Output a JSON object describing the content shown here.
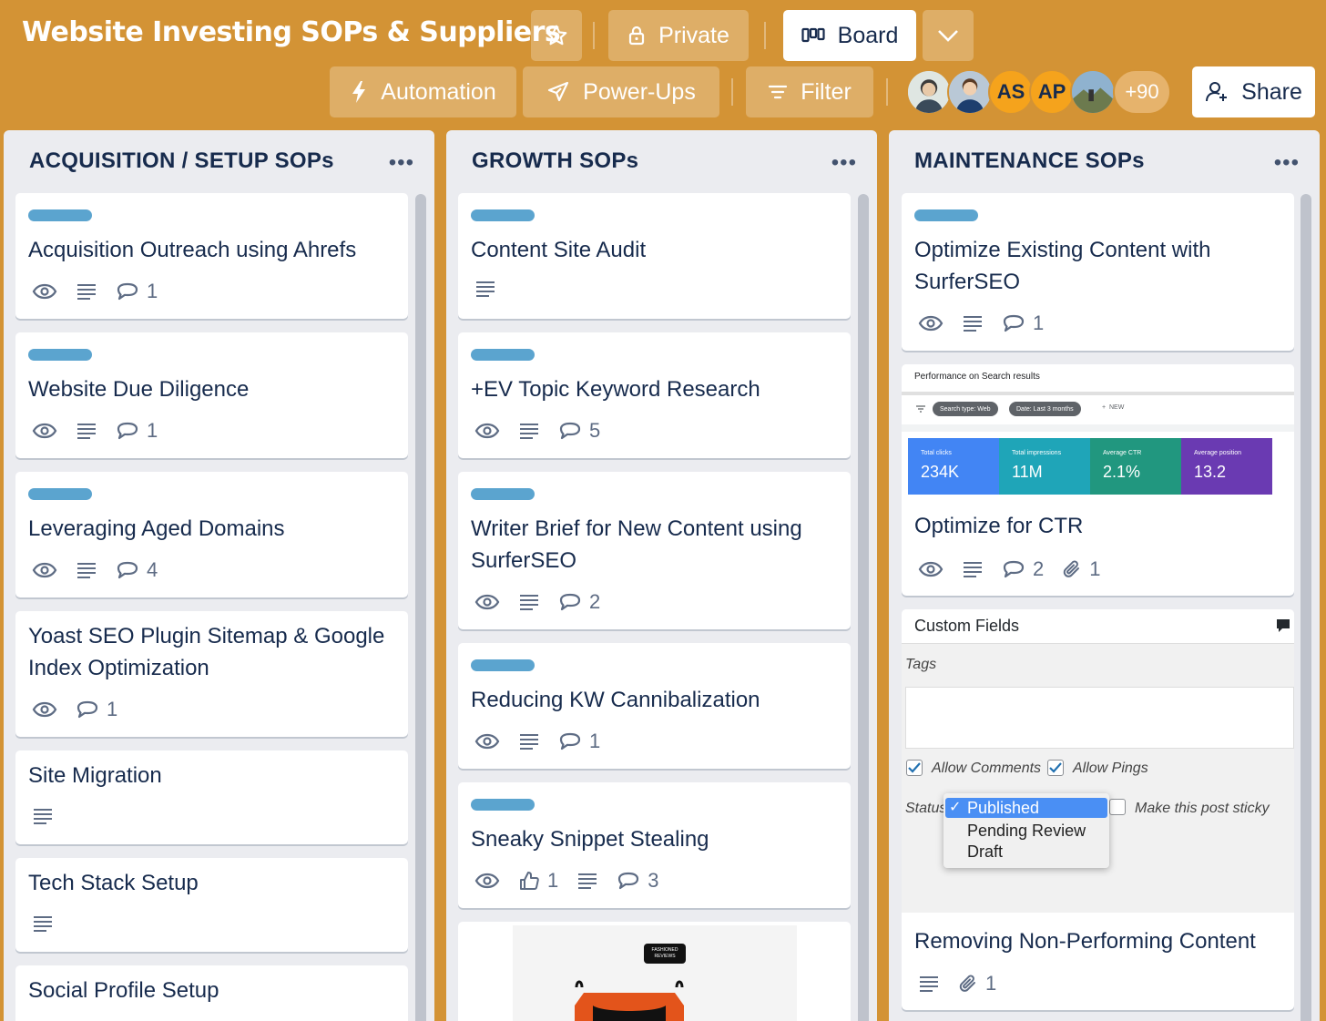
{
  "header": {
    "title": "Website Investing SOPs & Suppliers",
    "star_icon": "star-icon",
    "visibility_label": "Private",
    "view_label": "Board",
    "automation_label": "Automation",
    "powerups_label": "Power-Ups",
    "filter_label": "Filter",
    "share_label": "Share",
    "members": [
      "AS",
      "AP"
    ],
    "more_members": "+90"
  },
  "lists": [
    {
      "title": "ACQUISITION / SETUP SOPs",
      "cards": [
        {
          "title": "Acquisition Outreach using Ahrefs",
          "comments": "1"
        },
        {
          "title": "Website Due Diligence",
          "comments": "1"
        },
        {
          "title": "Leveraging Aged Domains",
          "comments": "4"
        },
        {
          "title_line1": "Yoast SEO Plugin Sitemap & Google",
          "title_line2": "Index Optimization",
          "comments": "1"
        },
        {
          "title": "Site Migration"
        },
        {
          "title": "Tech Stack Setup"
        },
        {
          "title": "Social Profile Setup"
        }
      ]
    },
    {
      "title": "GROWTH SOPs",
      "cards": [
        {
          "title": "Content Site Audit"
        },
        {
          "title": "+EV Topic Keyword Research",
          "comments": "5"
        },
        {
          "title_line1": "Writer Brief for New Content using",
          "title_line2": "SurferSEO",
          "comments": "2"
        },
        {
          "title": "Reducing KW Cannibalization",
          "comments": "1"
        },
        {
          "title": "Sneaky Snippet Stealing",
          "likes": "1",
          "comments": "3"
        },
        {
          "badge_text_1": "FASHIONED",
          "badge_text_2": "REVIEWS"
        }
      ]
    },
    {
      "title": "MAINTENANCE SOPs",
      "cards": [
        {
          "title_line1": "Optimize Existing Content with",
          "title_line2": "SurferSEO",
          "comments": "1"
        },
        {
          "title": "Optimize for CTR",
          "comments": "2",
          "attachments": "1",
          "cover": {
            "heading": "Performance on Search results",
            "chip1": "Search type: Web",
            "chip2": "Date: Last 3 months",
            "new_label": "NEW",
            "metrics": [
              {
                "label": "Total clicks",
                "value": "234K",
                "color": "#4285f4"
              },
              {
                "label": "Total impressions",
                "value": "11M",
                "color": "#1fa5b8"
              },
              {
                "label": "Average CTR",
                "value": "2.1%",
                "color": "#21977f"
              },
              {
                "label": "Average position",
                "value": "13.2",
                "color": "#6a3ab2"
              }
            ]
          }
        },
        {
          "title": "Removing Non-Performing Content",
          "attachments": "1",
          "cover": {
            "heading": "Custom Fields",
            "tags_label": "Tags",
            "allow_comments": "Allow Comments",
            "allow_pings": "Allow Pings",
            "status_label": "Status",
            "status_options": [
              "Published",
              "Pending Review",
              "Draft"
            ],
            "selected_mark": "✓",
            "sticky_label": "Make this post sticky"
          }
        }
      ]
    }
  ]
}
